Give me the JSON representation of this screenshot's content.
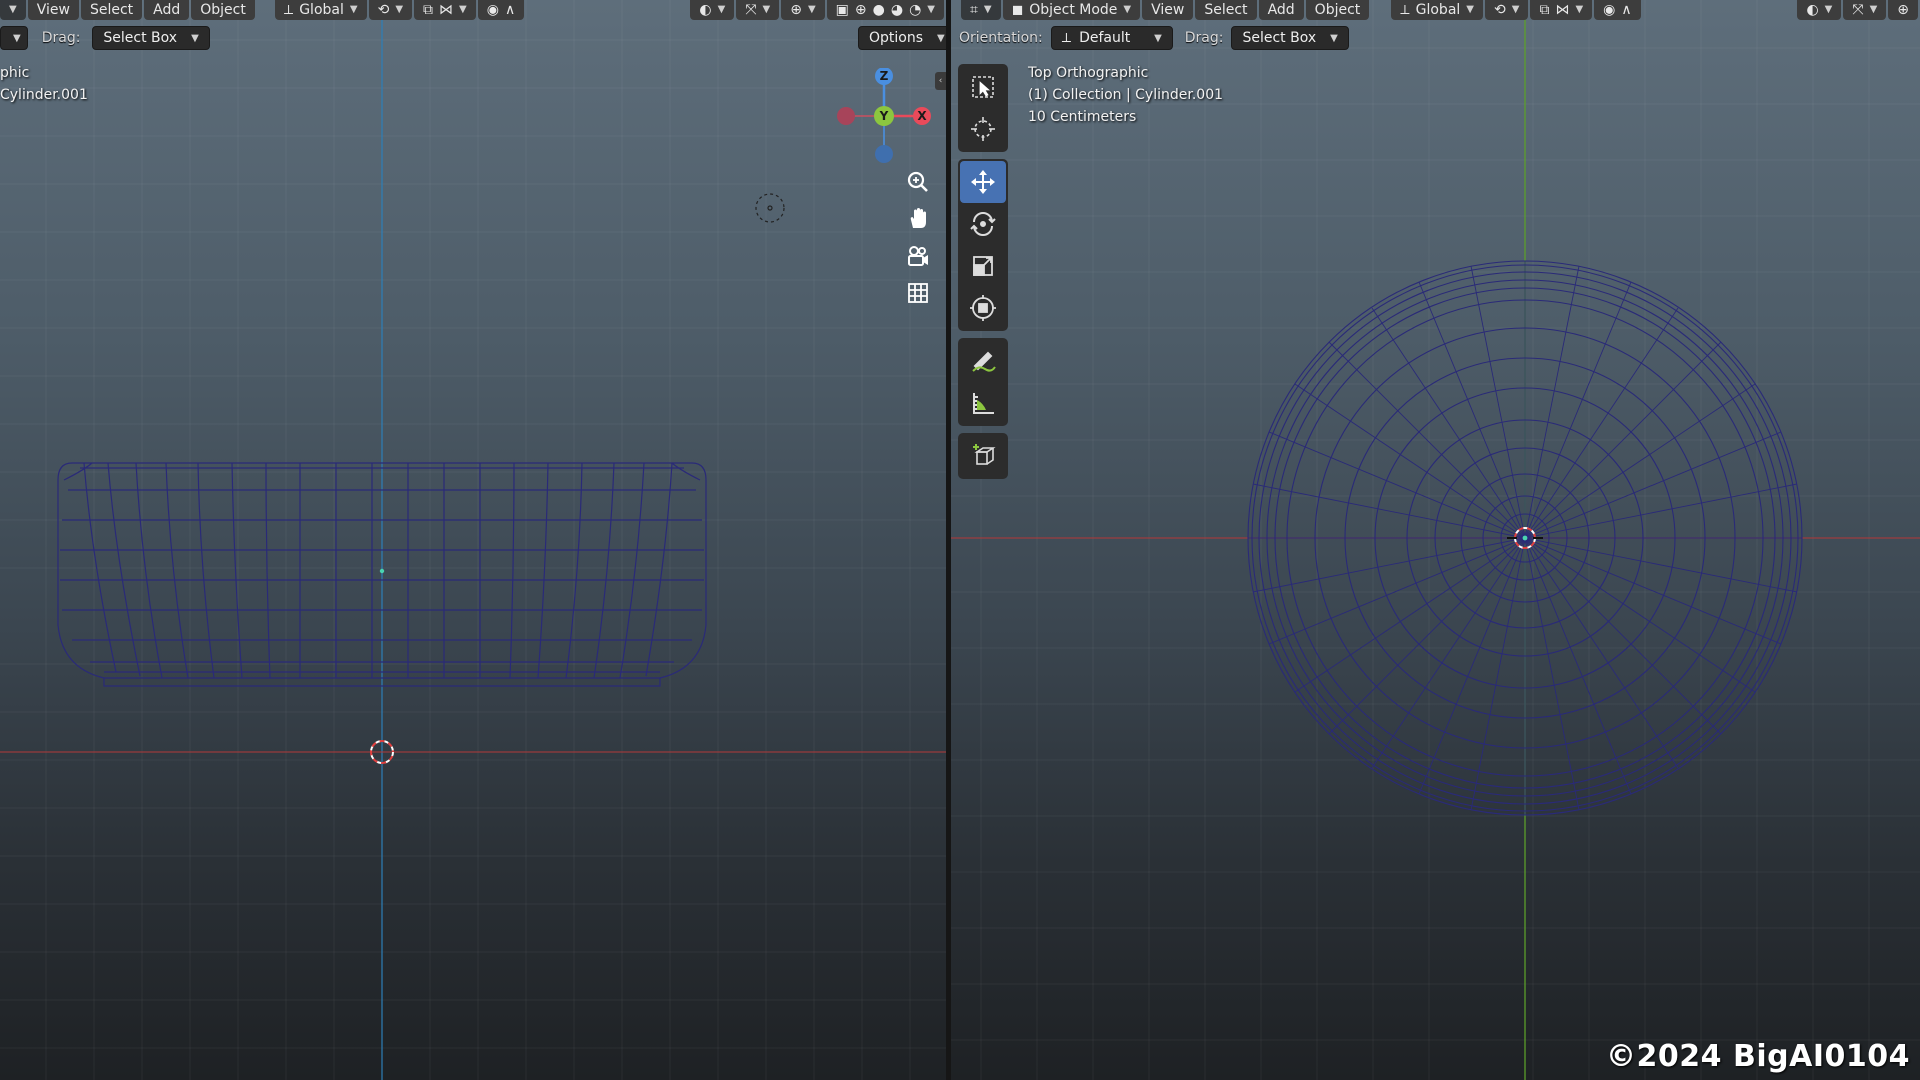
{
  "left_header": {
    "menu": [
      "View",
      "Select",
      "Add",
      "Object"
    ],
    "orientation_value": "Global",
    "drag_label": "Drag:",
    "drag_value": "Select Box",
    "options_label": "Options"
  },
  "left_info": {
    "line1": "phic",
    "line2": "Cylinder.001"
  },
  "right_header": {
    "mode": "Object Mode",
    "menu": [
      "View",
      "Select",
      "Add",
      "Object"
    ],
    "orientation_value": "Global",
    "orientation_label": "Orientation:",
    "orientation_dd": "Default",
    "drag_label": "Drag:",
    "drag_value": "Select Box"
  },
  "right_info": {
    "view_name": "Top Orthographic",
    "collection": "(1) Collection | Cylinder.001",
    "scale": "10 Centimeters"
  },
  "gizmo": {
    "z": "Z",
    "y": "Y",
    "x": "X",
    "colors": {
      "x": "#e94a5a",
      "y": "#8cc63f",
      "z": "#4a8fe0"
    }
  },
  "icons": {
    "toolbar": [
      "select-box-icon",
      "cursor-icon",
      "move-icon",
      "rotate-icon",
      "scale-icon",
      "transform-icon",
      "annotate-icon",
      "measure-icon",
      "add-cube-icon"
    ],
    "nav": [
      "zoom-icon",
      "pan-hand-icon",
      "camera-icon",
      "grid-view-icon"
    ]
  },
  "watermark": "©2024 BigAI0104"
}
